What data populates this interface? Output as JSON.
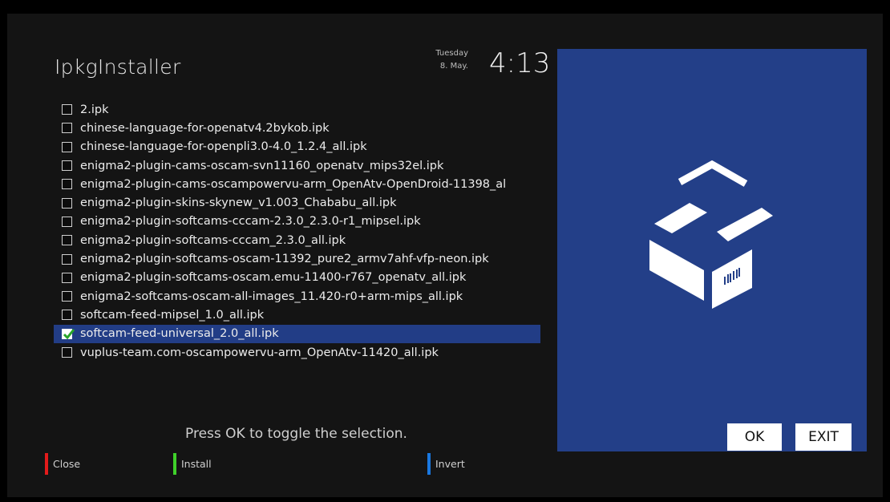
{
  "header": {
    "title": "IpkgInstaller",
    "day": "Tuesday",
    "date": "8. May.",
    "time": "4:13"
  },
  "packages": [
    {
      "name": "2.ipk",
      "checked": false,
      "selected": false
    },
    {
      "name": "chinese-language-for-openatv4.2bykob.ipk",
      "checked": false,
      "selected": false
    },
    {
      "name": "chinese-language-for-openpli3.0-4.0_1.2.4_all.ipk",
      "checked": false,
      "selected": false
    },
    {
      "name": "enigma2-plugin-cams-oscam-svn11160_openatv_mips32el.ipk",
      "checked": false,
      "selected": false
    },
    {
      "name": "enigma2-plugin-cams-oscampowervu-arm_OpenAtv-OpenDroid-11398_al",
      "checked": false,
      "selected": false
    },
    {
      "name": "enigma2-plugin-skins-skynew_v1.003_Chababu_all.ipk",
      "checked": false,
      "selected": false
    },
    {
      "name": "enigma2-plugin-softcams-cccam-2.3.0_2.3.0-r1_mipsel.ipk",
      "checked": false,
      "selected": false
    },
    {
      "name": "enigma2-plugin-softcams-cccam_2.3.0_all.ipk",
      "checked": false,
      "selected": false
    },
    {
      "name": "enigma2-plugin-softcams-oscam-11392_pure2_armv7ahf-vfp-neon.ipk",
      "checked": false,
      "selected": false
    },
    {
      "name": "enigma2-plugin-softcams-oscam.emu-11400-r767_openatv_all.ipk",
      "checked": false,
      "selected": false
    },
    {
      "name": "enigma2-softcams-oscam-all-images_11.420-r0+arm-mips_all.ipk",
      "checked": false,
      "selected": false
    },
    {
      "name": "softcam-feed-mipsel_1.0_all.ipk",
      "checked": false,
      "selected": false
    },
    {
      "name": "softcam-feed-universal_2.0_all.ipk",
      "checked": true,
      "selected": true
    },
    {
      "name": "vuplus-team.com-oscampowervu-arm_OpenAtv-11420_all.ipk",
      "checked": false,
      "selected": false
    }
  ],
  "hint": "Press OK to toggle the selection.",
  "footer": {
    "red": {
      "label": "Close",
      "color": "#e31b1b"
    },
    "green": {
      "label": "Install",
      "color": "#3fd12a"
    },
    "blue": {
      "label": "Invert",
      "color": "#1a78e0"
    }
  },
  "panel": {
    "icon": "package-box-icon",
    "ok_label": "OK",
    "exit_label": "EXIT",
    "background": "#233f88"
  }
}
